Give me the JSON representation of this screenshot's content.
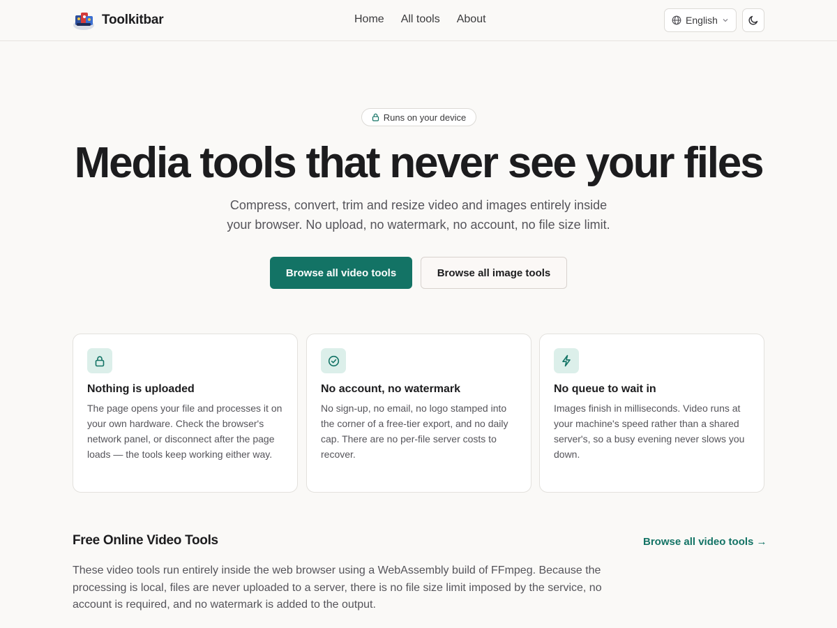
{
  "header": {
    "brand_name": "Toolkitbar",
    "nav": [
      "Home",
      "All tools",
      "About"
    ],
    "language": "English"
  },
  "hero": {
    "badge": "Runs on your device",
    "title": "Media tools that never see your files",
    "subtitle_line1": "Compress, convert, trim and resize video and images entirely inside",
    "subtitle_line2": "your browser. No upload, no watermark, no account, no file size limit.",
    "primary_button": "Browse all video tools",
    "secondary_button": "Browse all image tools"
  },
  "features": [
    {
      "icon": "lock-icon",
      "title": "Nothing is uploaded",
      "text": "The page opens your file and processes it on your own hardware. Check the browser's network panel, or disconnect after the page loads — the tools keep working either way."
    },
    {
      "icon": "check-circle-icon",
      "title": "No account, no watermark",
      "text": "No sign-up, no email, no logo stamped into the corner of a free-tier export, and no daily cap. There are no per-file server costs to recover."
    },
    {
      "icon": "lightning-icon",
      "title": "No queue to wait in",
      "text": "Images finish in milliseconds. Video runs at your machine's speed rather than a shared server's, so a busy evening never slows you down."
    }
  ],
  "video_section": {
    "title": "Free Online Video Tools",
    "link": "Browse all video tools →",
    "text": "These video tools run entirely inside the web browser using a WebAssembly build of FFmpeg. Because the processing is local, files are never uploaded to a server, there is no file size limit imposed by the service, no account is required, and no watermark is added to the output."
  },
  "colors": {
    "accent": "#137365",
    "icon_bg": "#dcefea",
    "background": "#faf9f7"
  }
}
